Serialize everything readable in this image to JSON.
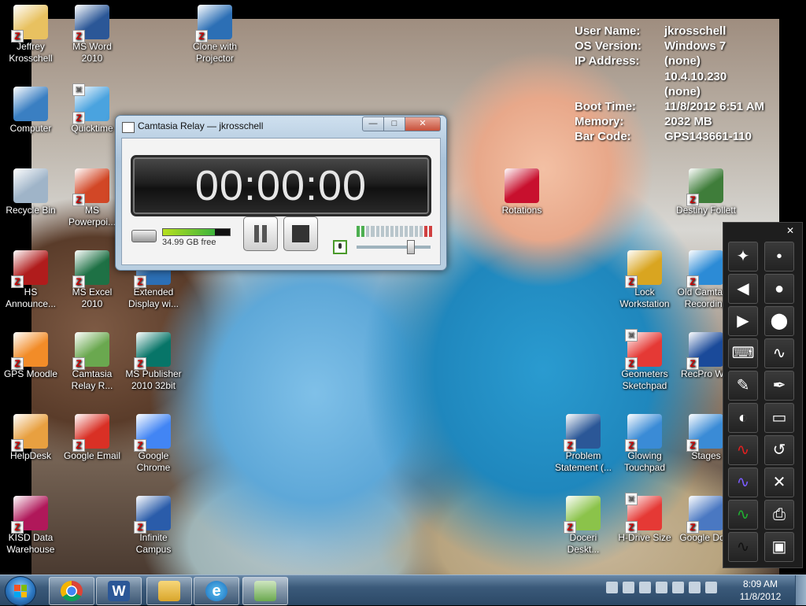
{
  "system_info": {
    "rows": [
      {
        "label": "User Name:",
        "value": "jkrosschell"
      },
      {
        "label": "OS Version:",
        "value": "Windows 7"
      },
      {
        "label": "IP Address:",
        "value": "(none)"
      },
      {
        "label": "",
        "value": "10.4.10.230"
      },
      {
        "label": "",
        "value": "(none)"
      },
      {
        "label": "Boot Time:",
        "value": "11/8/2012 6:51 AM"
      },
      {
        "label": "Memory:",
        "value": "2032 MB"
      },
      {
        "label": "Bar Code:",
        "value": "GPS143661-110"
      }
    ]
  },
  "desktop_icons": [
    {
      "label": "Jeffrey Krosschell",
      "icon": "folder-user-icon",
      "color": "#e8c160"
    },
    {
      "label": "MS Word 2010",
      "icon": "word-icon",
      "color": "#2b5797"
    },
    {
      "label": "Clone with Projector",
      "icon": "monitor-clone-icon",
      "color": "#2c6fb5"
    },
    {
      "label": "Computer",
      "icon": "computer-icon",
      "color": "#3a7fc2"
    },
    {
      "label": "Quicktime",
      "icon": "quicktime-icon",
      "color": "#4aa3df"
    },
    {
      "label": "Recycle Bin",
      "icon": "recycle-bin-icon",
      "color": "#9fb4c8"
    },
    {
      "label": "MS Powerpoi...",
      "icon": "powerpoint-icon",
      "color": "#d24726"
    },
    {
      "label": "Rotations",
      "icon": "pdf-icon",
      "color": "#c8102e"
    },
    {
      "label": "Destiny Follett",
      "icon": "tree-icon",
      "color": "#3f7d3a"
    },
    {
      "label": "HS Announce...",
      "icon": "hs-icon",
      "color": "#b01c1c"
    },
    {
      "label": "MS Excel 2010",
      "icon": "excel-icon",
      "color": "#1e7145"
    },
    {
      "label": "Extended Display wi...",
      "icon": "monitor-extend-icon",
      "color": "#2c6fb5"
    },
    {
      "label": "Lock Workstation",
      "icon": "lock-icon",
      "color": "#d9a520"
    },
    {
      "label": "Old Camtasia Recording",
      "icon": "globe-icon",
      "color": "#2c8bd6"
    },
    {
      "label": "GPS Moodle",
      "icon": "moodle-icon",
      "color": "#f28c28"
    },
    {
      "label": "Camtasia Relay R...",
      "icon": "camtasia-icon",
      "color": "#6aa84f"
    },
    {
      "label": "MS Publisher 2010 32bit",
      "icon": "publisher-icon",
      "color": "#077568"
    },
    {
      "label": "Geometers Sketchpad",
      "icon": "sketchpad-icon",
      "color": "#e53935"
    },
    {
      "label": "RecPro Win",
      "icon": "recpro-icon",
      "color": "#1a4a9a"
    },
    {
      "label": "HelpDesk",
      "icon": "lifesaver-icon",
      "color": "#e8a040"
    },
    {
      "label": "Google Email",
      "icon": "gmail-icon",
      "color": "#d93025"
    },
    {
      "label": "Google Chrome",
      "icon": "chrome-icon",
      "color": "#4285f4"
    },
    {
      "label": "Problem Statement (...",
      "icon": "word-doc-icon",
      "color": "#2b5797"
    },
    {
      "label": "Glowing Touchpad",
      "icon": "touchpad-icon",
      "color": "#3a8bd6"
    },
    {
      "label": "Stages",
      "icon": "stages-icon",
      "color": "#3a8bd6"
    },
    {
      "label": "KISD Data Warehouse",
      "icon": "kisd-icon",
      "color": "#b0185a"
    },
    {
      "label": "Infinite Campus",
      "icon": "campus-icon",
      "color": "#2a5caa"
    },
    {
      "label": "Doceri Deskt...",
      "icon": "doceri-icon",
      "color": "#8bc34a"
    },
    {
      "label": "H-Drive Size",
      "icon": "pie-chart-icon",
      "color": "#e53935"
    },
    {
      "label": "Google Do...",
      "icon": "google-docs-icon",
      "color": "#4a78c2"
    }
  ],
  "relay_window": {
    "title": "Camtasia Relay — jkrosschell",
    "timer": "00:00:00",
    "disk_free": "34.99 GB free",
    "disk_fill_fraction": 0.78
  },
  "taskbar": {
    "time": "8:09 AM",
    "date": "11/8/2012"
  }
}
